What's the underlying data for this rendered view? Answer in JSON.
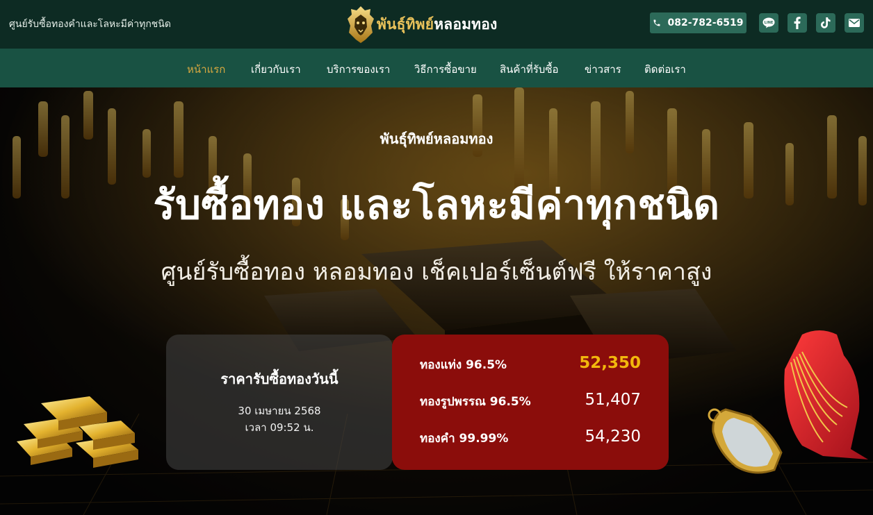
{
  "header": {
    "tagline": "ศูนย์รับซื้อทองคำและโลหะมีค่าทุกชนิด",
    "logo_gold": "พันธุ์ทิพย์",
    "logo_white": "หลอมทอง",
    "phone": "082-782-6519",
    "socials": [
      {
        "icon": "line-icon"
      },
      {
        "icon": "facebook-icon"
      },
      {
        "icon": "tiktok-icon"
      },
      {
        "icon": "mail-icon"
      }
    ]
  },
  "nav": {
    "items": [
      {
        "label": "หน้าแรก",
        "active": true
      },
      {
        "label": "เกี่ยวกับเรา"
      },
      {
        "label": "บริการของเรา"
      },
      {
        "label": "วิธีการซื้อขาย"
      },
      {
        "label": "สินค้าที่รับซื้อ"
      },
      {
        "label": "ข่าวสาร"
      },
      {
        "label": "ติดต่อเรา"
      }
    ]
  },
  "hero": {
    "eyebrow": "พันธุ์ทิพย์หลอมทอง",
    "headline": "รับซื้อทอง และโลหะมีค่าทุกชนิด",
    "subhead": "ศูนย์รับซื้อทอง หลอมทอง เช็คเปอร์เซ็นต์ฟรี ให้ราคาสูง"
  },
  "price_date": {
    "title": "ราคารับซื้อทองวันนี้",
    "date": "30 เมษายน 2568",
    "time": "เวลา 09:52 น."
  },
  "prices": [
    {
      "label": "ทองแท่ง 96.5%",
      "value": "52,350",
      "highlight": true
    },
    {
      "label": "ทองรูปพรรณ 96.5%",
      "value": "51,407"
    },
    {
      "label": "ทองคำ 99.99%",
      "value": "54,230"
    }
  ],
  "colors": {
    "topbar": "#0d2b23",
    "nav": "#195243",
    "accent_gold": "#d9a940",
    "price_bg": "#8b0d0b",
    "price_highlight": "#f2b70d"
  }
}
